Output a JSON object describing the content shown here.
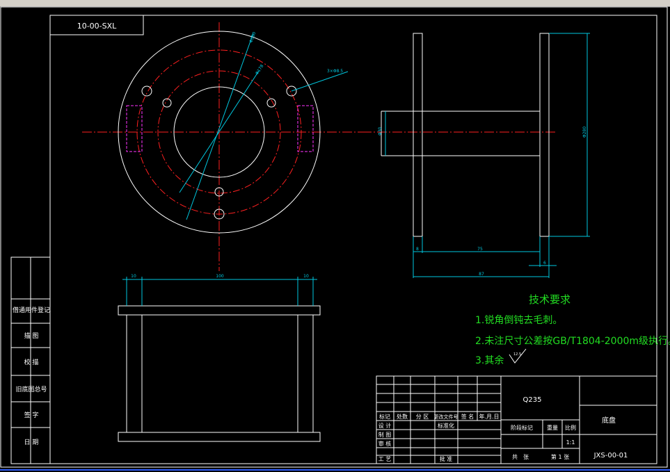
{
  "drawing_code_top": "10-00-SXL",
  "dimensions": {
    "front_outer_dia": "Φ280",
    "front_inner_dia": "Φ178",
    "front_holes": "3×Φ8.5",
    "side_hub_dia": "Φ30",
    "side_outer_dia": "Φ280",
    "side_left_thk": "8",
    "side_span": "75",
    "side_right_thk": "6",
    "side_total": "87",
    "bottom_left_thk": "10",
    "bottom_span": "100",
    "bottom_right_thk": "10"
  },
  "side_labels": [
    "借通用件登记",
    "描 图",
    "校 描",
    "旧底图总号",
    "签 字",
    "日 期"
  ],
  "tech": {
    "title": "技术要求",
    "item1": "1.锐角倒钝去毛刺。",
    "item2": "2.未注尺寸公差按GB/T1804-2000m级执行。",
    "item3": "3.其余",
    "roughness": "12.5"
  },
  "titleblock": {
    "material": "Q235",
    "part_name": "底盘",
    "drawing_no": "JXS-00-01",
    "h_mark": "标记",
    "h_count": "处数",
    "h_zone": "分 区",
    "h_docno": "更改文件号",
    "h_sign": "签 名",
    "h_date": "年.月.日",
    "r_design": "设 计",
    "r_std": "标准化",
    "r_check": "制 图",
    "r_review": "审 核",
    "r_process": "工 艺",
    "r_approve": "批 准",
    "stage_mark": "阶段标记",
    "weight": "重量",
    "scale_label": "比例",
    "scale": "1:1",
    "sheets_total": "共　张",
    "sheet_no": "第 1 张"
  }
}
